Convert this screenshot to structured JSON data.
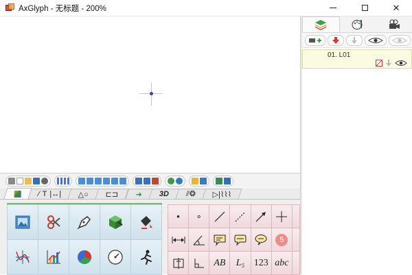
{
  "window": {
    "title": "AxGlyph - 无标题 - 200%",
    "minimize": "minimize",
    "maximize": "maximize",
    "close": "✕"
  },
  "right_panel": {
    "tabs": [
      "layers-icon",
      "palette-icon",
      "camera-icon"
    ],
    "layer": {
      "name": "01. L01"
    }
  },
  "bottom_panel": {
    "tabs": [
      {
        "label": "",
        "icon": "image-icon"
      },
      {
        "label": "T",
        "icon": "line-text-icon"
      },
      {
        "label": "△○",
        "icon": "shapes-icon"
      },
      {
        "label": "",
        "icon": "connector-icon"
      },
      {
        "label": "",
        "icon": "arrow-icon"
      },
      {
        "label": "3D",
        "icon": "3d-icon"
      },
      {
        "label": "",
        "icon": "pattern-icon"
      },
      {
        "label": "",
        "icon": "diode-icon"
      }
    ],
    "big_icons": [
      "picture-icon",
      "scissors-icon",
      "pen-icon",
      "cube-icon",
      "paint-bucket-icon",
      "graph-icon",
      "chart-icon",
      "pie-chart-icon",
      "gauge-icon",
      "runner-icon"
    ],
    "small_cells": [
      {
        "text": "•",
        "icon": "dot-icon"
      },
      {
        "text": "∘",
        "icon": "circle-dot-icon"
      },
      {
        "text": "",
        "icon": "line-icon"
      },
      {
        "text": "",
        "icon": "dashed-line-icon"
      },
      {
        "text": "",
        "icon": "arrow-line-icon"
      },
      {
        "text": "",
        "icon": "crosshair-icon"
      },
      {
        "text": "",
        "icon": "double-arrow-icon"
      },
      {
        "text": "",
        "icon": "angle-icon"
      },
      {
        "text": "",
        "icon": "callout-rect-icon"
      },
      {
        "text": "",
        "icon": "callout-round-icon"
      },
      {
        "text": "",
        "icon": "callout-cloud-icon"
      },
      {
        "text": "5",
        "icon": "number-badge-icon"
      },
      {
        "text": "",
        "icon": "text-frame-icon"
      },
      {
        "text": "",
        "icon": "corner-icon"
      },
      {
        "text": "AB",
        "icon": "text-ab-icon"
      },
      {
        "text": "L₅",
        "icon": "subscript-icon"
      },
      {
        "text": "123",
        "icon": "number-text-icon"
      },
      {
        "text": "abc",
        "icon": "abc-text-icon"
      }
    ]
  }
}
